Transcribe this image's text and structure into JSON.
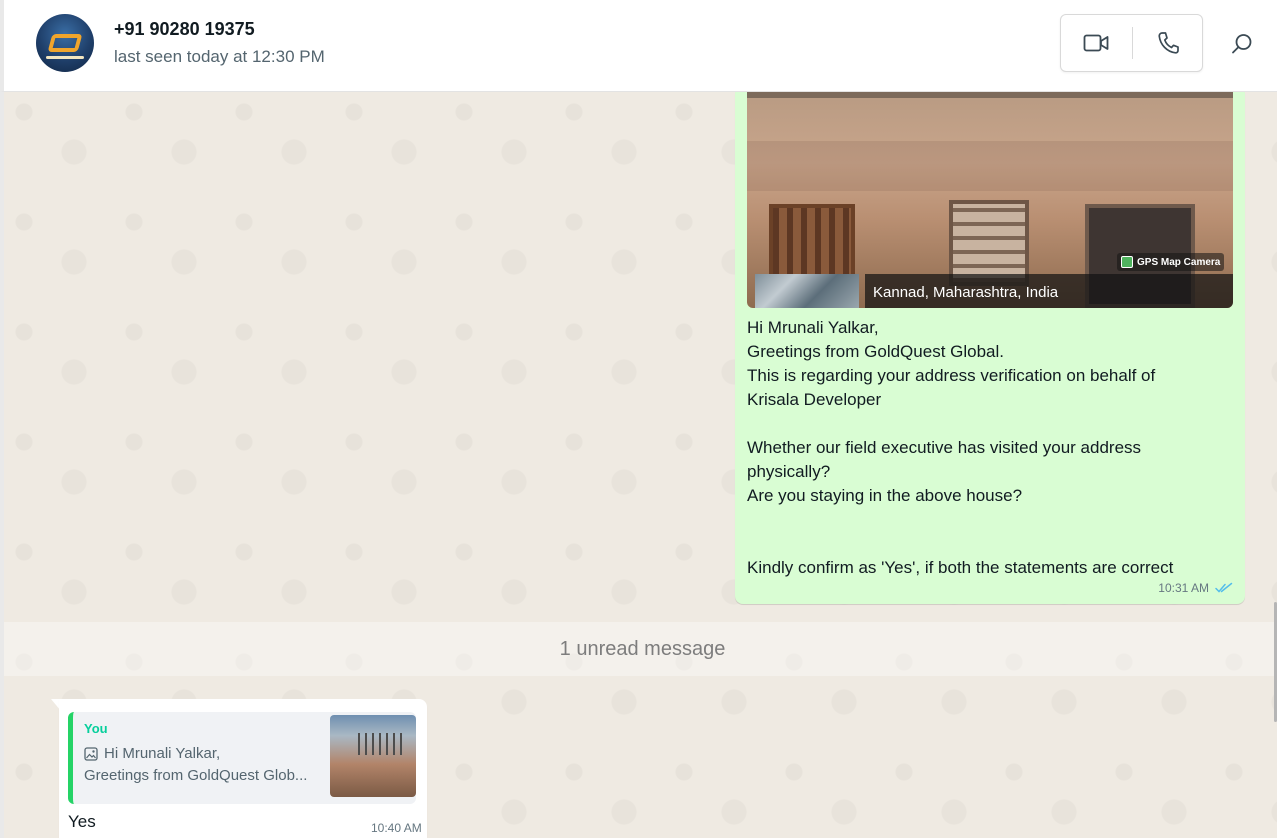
{
  "header": {
    "contact_name": "+91 90280 19375",
    "last_seen": "last seen today at 12:30 PM"
  },
  "outgoing_message": {
    "photo_location": "Kannad, Maharashtra, India",
    "photo_watermark": "GPS Map Camera",
    "lines": [
      "Hi Mrunali Yalkar,",
      "Greetings from GoldQuest Global.",
      "This is regarding your address verification on behalf of",
      "Krisala Developer",
      "",
      "Whether our field executive has visited your address",
      "physically?",
      "Are you staying in the above house?",
      "",
      "",
      "Kindly confirm as 'Yes', if both the statements are correct"
    ],
    "time": "10:31 AM",
    "status_color": "#53bdeb"
  },
  "unread_divider": {
    "label": "1 unread message"
  },
  "incoming_message": {
    "quote_author": "You",
    "quote_line1": "Hi Mrunali Yalkar,",
    "quote_line2": "Greetings from GoldQuest Glob...",
    "text": "Yes",
    "time": "10:40 AM"
  },
  "colors": {
    "outgoing_bubble": "#d9fdd3",
    "incoming_bubble": "#ffffff",
    "chat_background": "#efeae2",
    "quote_accent": "#25d366"
  },
  "icons": {
    "video_call": "video-camera-icon",
    "voice_call": "phone-icon",
    "search": "search-icon",
    "read_receipt": "double-check-icon",
    "quote_photo": "photo-icon"
  }
}
